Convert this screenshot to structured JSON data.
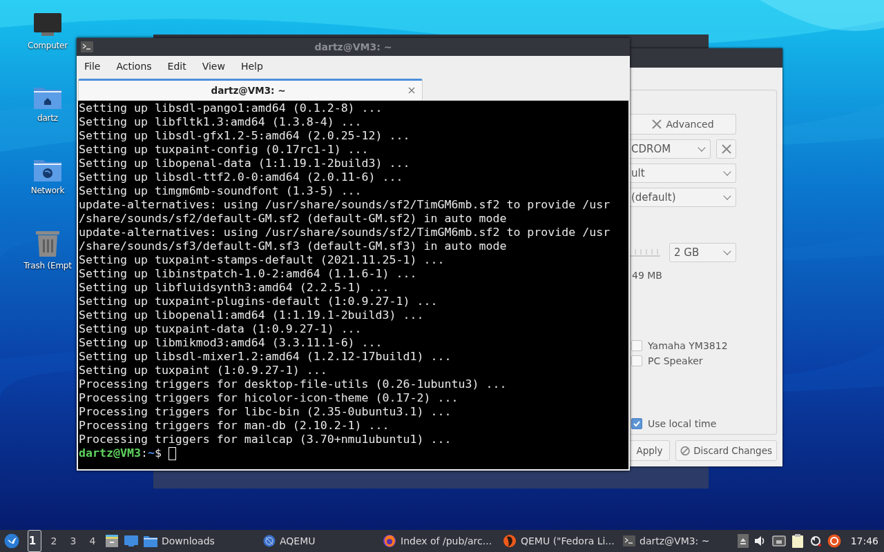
{
  "desktop_icons": [
    {
      "kind": "computer",
      "label": "Computer"
    },
    {
      "kind": "home",
      "label": "dartz"
    },
    {
      "kind": "network",
      "label": "Network"
    },
    {
      "kind": "trash",
      "label": "Trash (Empt"
    }
  ],
  "settings_window": {
    "advanced_button": "Advanced",
    "cdrom_select": "CDROM",
    "select_2": "ult",
    "select_3": "(default)",
    "memory_select": "2 GB",
    "memory_note": "49 MB",
    "checkboxes": [
      {
        "label": "Yamaha YM3812",
        "checked": false
      },
      {
        "label": "PC Speaker",
        "checked": false
      },
      {
        "label": "Use local time",
        "checked": true
      }
    ],
    "buttons": [
      {
        "kind": "apply",
        "label": "Apply"
      },
      {
        "kind": "discard",
        "label": "Discard Changes"
      }
    ]
  },
  "terminal": {
    "title": "dartz@VM3: ~",
    "menu": [
      "File",
      "Actions",
      "Edit",
      "View",
      "Help"
    ],
    "tabs": [
      {
        "label": "dartz@VM3: ~",
        "selected": true
      }
    ],
    "lines": [
      "Setting up libsdl-pango1:amd64 (0.1.2-8) ...",
      "Setting up libfltk1.3:amd64 (1.3.8-4) ...",
      "Setting up libsdl-gfx1.2-5:amd64 (2.0.25-12) ...",
      "Setting up tuxpaint-config (0.17rc1-1) ...",
      "Setting up libopenal-data (1:1.19.1-2build3) ...",
      "Setting up libsdl-ttf2.0-0:amd64 (2.0.11-6) ...",
      "Setting up timgm6mb-soundfont (1.3-5) ...",
      "update-alternatives: using /usr/share/sounds/sf2/TimGM6mb.sf2 to provide /usr",
      "/share/sounds/sf2/default-GM.sf2 (default-GM.sf2) in auto mode",
      "update-alternatives: using /usr/share/sounds/sf2/TimGM6mb.sf2 to provide /usr",
      "/share/sounds/sf3/default-GM.sf3 (default-GM.sf3) in auto mode",
      "Setting up tuxpaint-stamps-default (2021.11.25-1) ...",
      "Setting up libinstpatch-1.0-2:amd64 (1.1.6-1) ...",
      "Setting up libfluidsynth3:amd64 (2.2.5-1) ...",
      "Setting up tuxpaint-plugins-default (1:0.9.27-1) ...",
      "Setting up libopenal1:amd64 (1:1.19.1-2build3) ...",
      "Setting up tuxpaint-data (1:0.9.27-1) ...",
      "Setting up libmikmod3:amd64 (3.3.11.1-6) ...",
      "Setting up libsdl-mixer1.2:amd64 (1.2.12-17build1) ...",
      "Setting up tuxpaint (1:0.9.27-1) ...",
      "Processing triggers for desktop-file-utils (0.26-1ubuntu3) ...",
      "Processing triggers for hicolor-icon-theme (0.17-2) ...",
      "Processing triggers for libc-bin (2.35-0ubuntu3.1) ...",
      "Processing triggers for man-db (2.10.2-1) ...",
      "Processing triggers for mailcap (3.70+nmu1ubuntu1) ..."
    ],
    "prompt": {
      "user_host": "dartz@VM3",
      "separator": ":",
      "path": "~",
      "symbol": "$"
    }
  },
  "taskbar": {
    "workspaces": [
      {
        "label": "1",
        "selected": true
      },
      {
        "label": "2",
        "selected": false
      },
      {
        "label": "3",
        "selected": false
      },
      {
        "label": "4",
        "selected": false
      }
    ],
    "tasks": [
      {
        "kind": "folder",
        "label": "Downloads"
      },
      {
        "kind": "aqemu",
        "label": "AQEMU"
      },
      {
        "kind": "browser",
        "label": "Index of /pub/arc..."
      },
      {
        "kind": "qemu",
        "label": "QEMU (\"Fedora Li..."
      },
      {
        "kind": "terminal",
        "label": "dartz@VM3: ~"
      }
    ],
    "clock": "17:46"
  }
}
